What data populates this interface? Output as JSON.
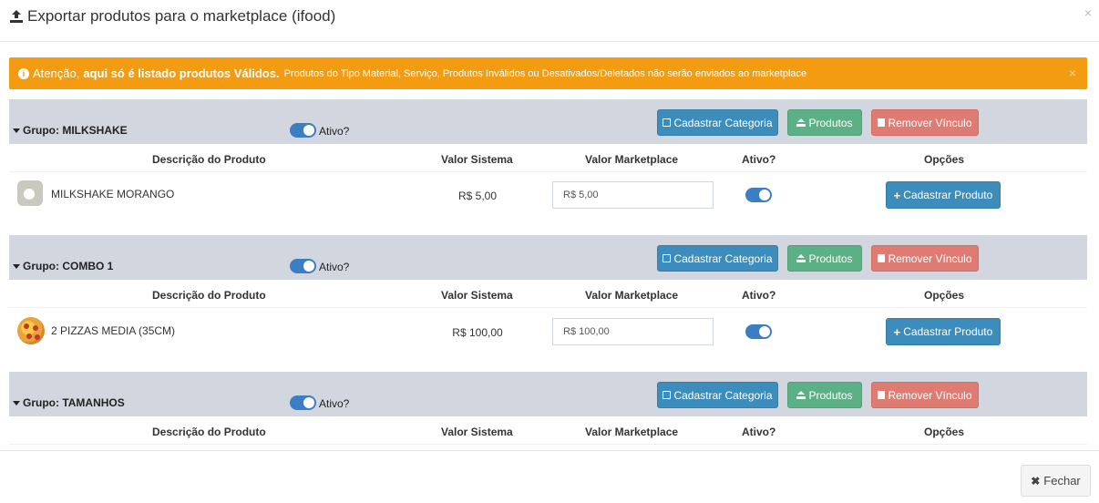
{
  "modal": {
    "title": "Exportar produtos para o marketplace (ifood)",
    "close_icon": "×"
  },
  "alert": {
    "lead": "Atenção,",
    "bold": "aqui só é listado produtos Válidos.",
    "text": "Produtos do Tipo Material, Serviço, Produtos Inválidos ou Desativados/Deletados não serão enviados ao marketplace",
    "close_icon": "×",
    "color": "#f39c12"
  },
  "columns": {
    "descricao": "Descrição do Produto",
    "valor_sistema": "Valor Sistema",
    "valor_marketplace": "Valor Marketplace",
    "ativo": "Ativo?",
    "opcoes": "Opções"
  },
  "buttons": {
    "cadastrar_categoria": "Cadastrar Categoria",
    "produtos": "Produtos",
    "remover_vinculo": "Remover Vínculo",
    "cadastrar_produto": "Cadastrar Produto",
    "fechar": "Fechar"
  },
  "groups": [
    {
      "title": "Grupo: MILKSHAKE",
      "active_label": "Ativo?",
      "active": true,
      "product": {
        "name": "MILKSHAKE MORANGO",
        "valor_sistema": "R$ 5,00",
        "valor_marketplace": "R$ 5,00",
        "active": true,
        "image": "camera-placeholder-icon"
      }
    },
    {
      "title": "Grupo: COMBO 1",
      "active_label": "Ativo?",
      "active": true,
      "product": {
        "name": "2 PIZZAS MEDIA (35CM)",
        "valor_sistema": "R$ 100,00",
        "valor_marketplace": "R$ 100,00",
        "active": true,
        "image": "pizza-icon"
      }
    },
    {
      "title": "Grupo: TAMANHOS",
      "active_label": "Ativo?",
      "active": true
    }
  ],
  "colors": {
    "group_bar": "#d2d6de",
    "primary": "#3c8dbc",
    "success": "#5cb085",
    "danger": "#de7c74",
    "toggle": "#3c7ec4"
  }
}
